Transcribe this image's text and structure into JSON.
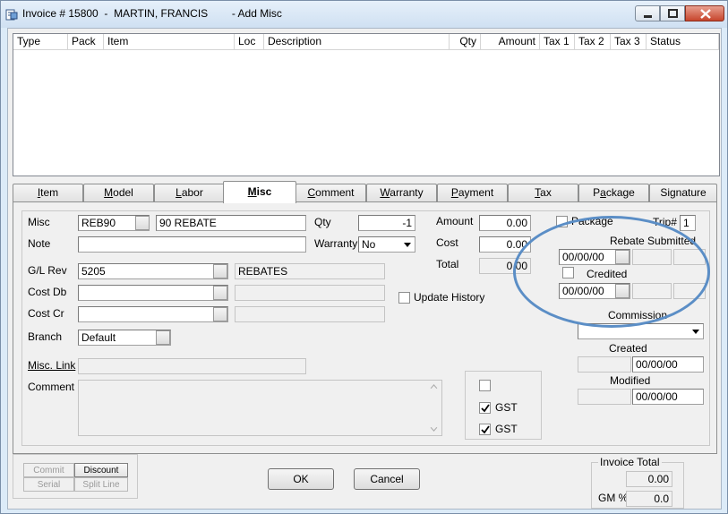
{
  "window": {
    "title": "Invoice # 15800  -  MARTIN, FRANCIS        - Add Misc"
  },
  "listview": {
    "columns": [
      "Type",
      "Pack",
      "Item",
      "Loc",
      "Description",
      "Qty",
      "Amount",
      "Tax 1",
      "Tax 2",
      "Tax 3",
      "Status"
    ]
  },
  "tabs": [
    {
      "label": "Item",
      "u": "I",
      "rest": "tem"
    },
    {
      "label": "Model",
      "u": "M",
      "rest": "odel"
    },
    {
      "label": "Labor",
      "u": "L",
      "rest": "abor"
    },
    {
      "label": "Misc",
      "u": "M",
      "rest": "isc"
    },
    {
      "label": "Comment",
      "u": "C",
      "rest": "omment"
    },
    {
      "label": "Warranty",
      "u": "W",
      "rest": "arranty"
    },
    {
      "label": "Payment",
      "u": "P",
      "rest": "ayment"
    },
    {
      "label": "Tax",
      "u": "T",
      "rest": "ax"
    },
    {
      "label": "Package",
      "u": "a",
      "pre": "P",
      "rest": "ckage"
    },
    {
      "label": "Signature",
      "u": "",
      "rest": "Signature"
    }
  ],
  "misc": {
    "misc_label": "Misc",
    "misc_code": "REB90",
    "misc_desc": "90 REBATE",
    "note_label": "Note",
    "note_value": "",
    "glrev_label": "G/L Rev",
    "glrev_value": "5205",
    "glrev_desc": "REBATES",
    "costdb_label": "Cost Db",
    "costcr_label": "Cost Cr",
    "branch_label": "Branch",
    "branch_value": "Default",
    "misclink_label": "Misc. Link",
    "comment_label": "Comment",
    "qty_label": "Qty",
    "qty_value": "-1",
    "warranty_label": "Warranty",
    "warranty_value": "No",
    "update_history_label": "Update History",
    "amount_label": "Amount",
    "amount_value": "0.00",
    "cost_label": "Cost",
    "cost_value": "0.00",
    "total_label": "Total",
    "total_value": "0.00",
    "package_label": "Package",
    "trip_label": "Trip#",
    "trip_value": "1",
    "rebate_submitted_label": "Rebate Submitted",
    "rebate_date": "00/00/00",
    "credited_label": "Credited",
    "credited_date": "00/00/00",
    "commission_label": "Commission",
    "created_label": "Created",
    "created_date": "00/00/00",
    "modified_label": "Modified",
    "modified_date": "00/00/00",
    "gst1_label": "GST",
    "gst2_label": "GST"
  },
  "bottom": {
    "commit_label": "Commit",
    "discount_label": "Discount",
    "serial_label": "Serial",
    "split_line_label": "Split Line",
    "ok_label": "OK",
    "cancel_label": "Cancel",
    "invoice_total_label": "Invoice Total",
    "invoice_total_value": "0.00",
    "gm_label": "GM %",
    "gm_value": "0.0"
  }
}
